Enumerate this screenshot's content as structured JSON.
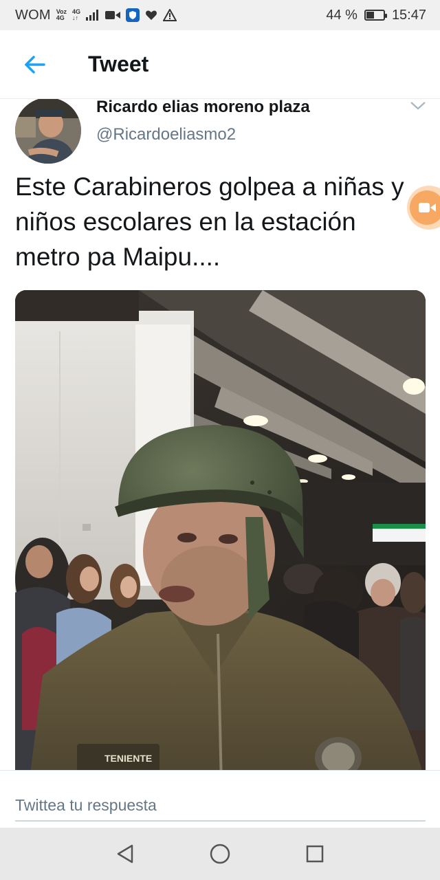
{
  "status_bar": {
    "carrier": "WOM",
    "voz_label": "Voz",
    "voz_sub": "4G",
    "net_top": "4G",
    "net_bottom": "↓↑",
    "battery_percent": "44 %",
    "battery_level": 0.44,
    "time": "15:47"
  },
  "header": {
    "title": "Tweet"
  },
  "tweet": {
    "author_name": "Ricardo elias moreno plaza",
    "author_handle": "@Ricardoeliasmo2",
    "text": "Este Carabineros golpea a niñas y niños escolares en la estación metro pa Maipu...."
  },
  "reply": {
    "placeholder": "Twittea tu respuesta"
  },
  "colors": {
    "accent": "#1da1f2",
    "float_button": "#f7a964"
  }
}
